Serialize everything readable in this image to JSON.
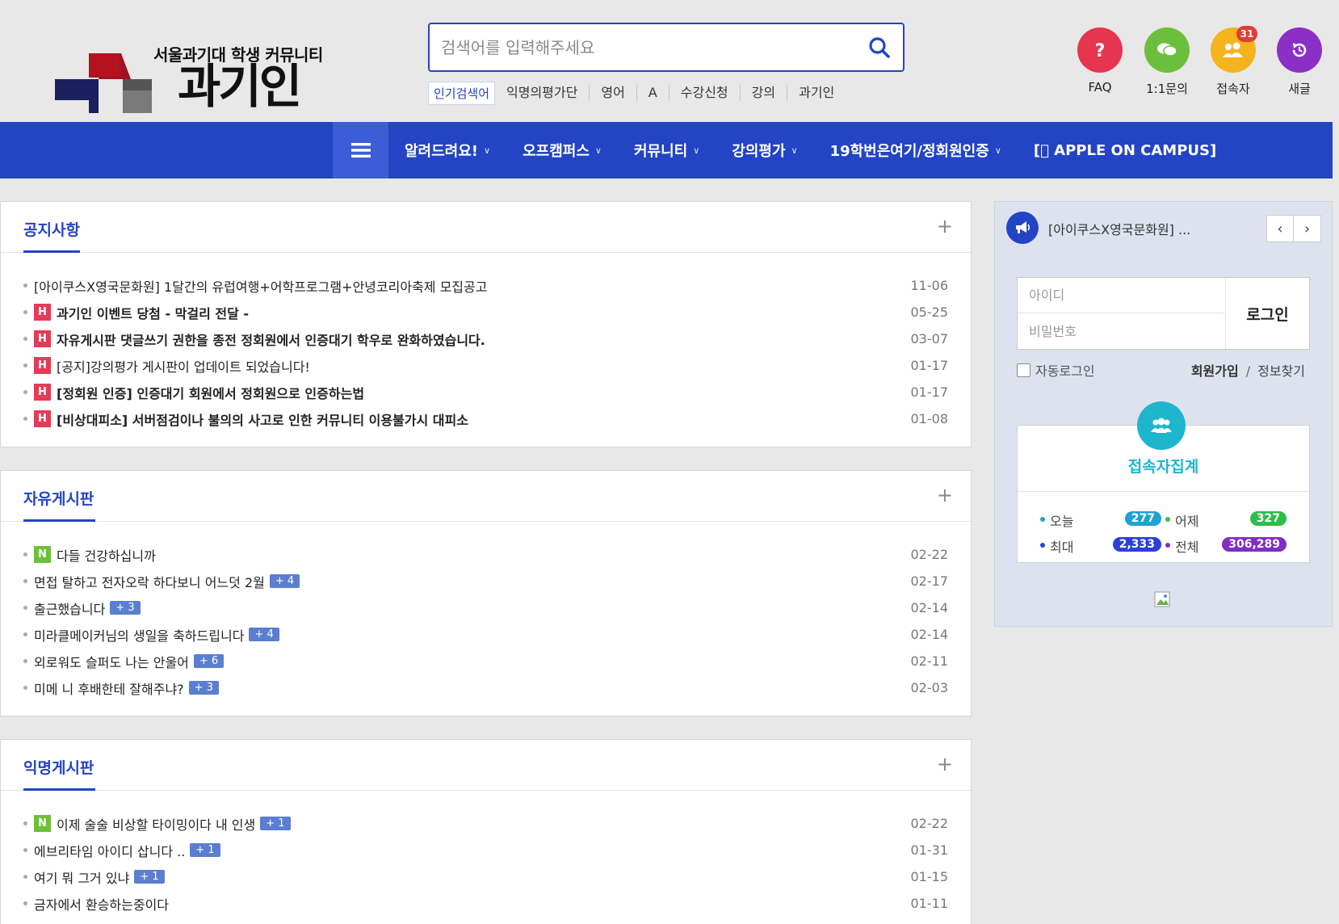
{
  "logo": {
    "subtitle": "서울과기대 학생 커뮤니티",
    "name": "과기인"
  },
  "search": {
    "placeholder": "검색어를 입력해주세요",
    "popular_label": "인기검색어",
    "popular": [
      "익명의평가단",
      "영어",
      "A",
      "수강신청",
      "강의",
      "과기인"
    ]
  },
  "quick_links": [
    {
      "label": "FAQ",
      "icon": "question-icon",
      "color": "#e6354f"
    },
    {
      "label": "1:1문의",
      "icon": "chat-icon",
      "color": "#6cbf3c"
    },
    {
      "label": "접속자",
      "icon": "users-icon",
      "color": "#f5b31e",
      "badge": "31"
    },
    {
      "label": "새글",
      "icon": "history-icon",
      "color": "#8c2fc7"
    }
  ],
  "nav": {
    "items": [
      "알려드려요!",
      "오프캠퍼스",
      "커뮤니티",
      "강의평가",
      "19학번은여기/정회원인증",
      "[ APPLE ON CAMPUS]"
    ]
  },
  "colors": {
    "brand": "#2344c4",
    "hot_tag": "#e43b57",
    "new_tag": "#6cc03a",
    "comment_badge": "#5b7ed0",
    "stats_accent": "#1db6ce"
  },
  "panels": [
    {
      "title": "공지사항",
      "posts": [
        {
          "tag": "",
          "title": "[아이쿠스X영국문화원] 1달간의 유럽여행+어학프로그램+안녕코리아축제 모집공고",
          "bold": false,
          "comments": "",
          "date": "11-06"
        },
        {
          "tag": "H",
          "title": "과기인 이벤트 당첨 - 막걸리 전달 -",
          "bold": true,
          "comments": "",
          "date": "05-25"
        },
        {
          "tag": "H",
          "title": "자유게시판 댓글쓰기 권한을 종전 정회원에서 인증대기 학우로 완화하였습니다.",
          "bold": true,
          "comments": "",
          "date": "03-07"
        },
        {
          "tag": "H",
          "title": "[공지]강의평가 게시판이 업데이트 되었습니다!",
          "bold": false,
          "comments": "",
          "date": "01-17"
        },
        {
          "tag": "H",
          "title": "[정회원 인증] 인증대기 회원에서 정회원으로 인증하는법",
          "bold": true,
          "comments": "",
          "date": "01-17"
        },
        {
          "tag": "H",
          "title": "[비상대피소] 서버점검이나 불의의 사고로 인한 커뮤니티 이용불가시 대피소",
          "bold": true,
          "comments": "",
          "date": "01-08"
        }
      ]
    },
    {
      "title": "자유게시판",
      "posts": [
        {
          "tag": "N",
          "title": "다들 건강하십니까",
          "bold": false,
          "comments": "",
          "date": "02-22"
        },
        {
          "tag": "",
          "title": "면접 탈하고 전자오락 하다보니 어느덧 2월",
          "bold": false,
          "comments": "+ 4",
          "date": "02-17"
        },
        {
          "tag": "",
          "title": "출근했습니다",
          "bold": false,
          "comments": "+ 3",
          "date": "02-14"
        },
        {
          "tag": "",
          "title": "미라클메이커님의 생일을 축하드립니다",
          "bold": false,
          "comments": "+ 4",
          "date": "02-14"
        },
        {
          "tag": "",
          "title": "외로워도 슬퍼도 나는 안울어",
          "bold": false,
          "comments": "+ 6",
          "date": "02-11"
        },
        {
          "tag": "",
          "title": "미메 니 후배한테 잘해주냐?",
          "bold": false,
          "comments": "+ 3",
          "date": "02-03"
        }
      ]
    },
    {
      "title": "익명게시판",
      "posts": [
        {
          "tag": "N",
          "title": "이제 술술 비상할 타이밍이다 내 인생",
          "bold": false,
          "comments": "+ 1",
          "date": "02-22"
        },
        {
          "tag": "",
          "title": "에브리타임 아이디 삽니다 ..",
          "bold": false,
          "comments": "+ 1",
          "date": "01-31"
        },
        {
          "tag": "",
          "title": "여기 뭐 그거 있냐",
          "bold": false,
          "comments": "+ 1",
          "date": "01-15"
        },
        {
          "tag": "",
          "title": "금자에서 환승하는중이다",
          "bold": false,
          "comments": "",
          "date": "01-11"
        }
      ]
    }
  ],
  "sidebar": {
    "notice": "[아이쿠스X영국문화원] ...",
    "prev": "‹",
    "next": "›",
    "login": {
      "id_placeholder": "아이디",
      "pw_placeholder": "비밀번호",
      "button": "로그인",
      "auto_login": "자동로그인",
      "join": "회원가입",
      "separator": "/",
      "find": "정보찾기"
    },
    "stats": {
      "title": "접속자집계",
      "items": [
        {
          "label": "오늘",
          "value": "277",
          "color": "#1da1d6"
        },
        {
          "label": "어제",
          "value": "327",
          "color": "#2ebd4a"
        },
        {
          "label": "최대",
          "value": "2,333",
          "color": "#2d3fd8"
        },
        {
          "label": "전체",
          "value": "306,289",
          "color": "#7f2fc4"
        }
      ]
    }
  },
  "ui": {
    "panel_more": "+"
  }
}
